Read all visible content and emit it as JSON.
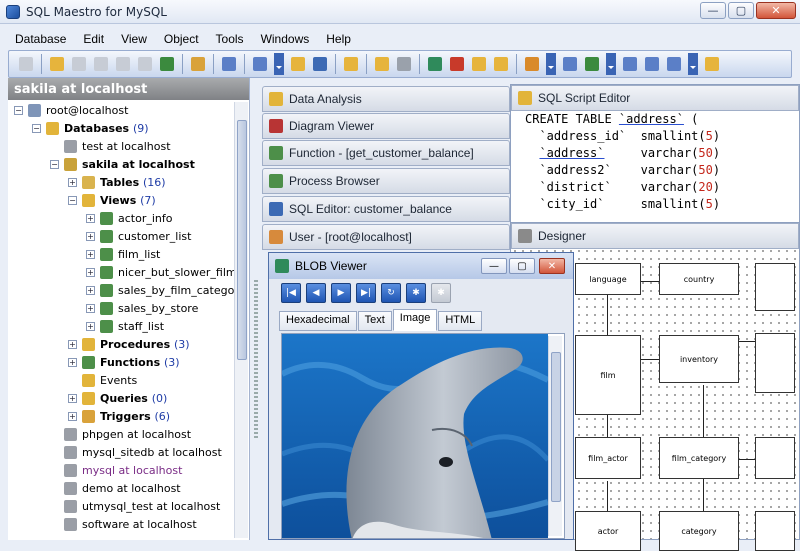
{
  "window": {
    "title": "SQL Maestro for MySQL"
  },
  "menu": [
    "Database",
    "Edit",
    "View",
    "Object",
    "Tools",
    "Windows",
    "Help"
  ],
  "explorer": {
    "header": "sakila at localhost",
    "items": [
      {
        "depth": 0,
        "exp": "-",
        "label": "root@localhost",
        "icon": "server-icon",
        "color": "#7f95b8"
      },
      {
        "depth": 1,
        "exp": "-",
        "label": "Databases",
        "count": "(9)",
        "bold": true,
        "icon": "databases-folder-icon",
        "color": "#e2b43a"
      },
      {
        "depth": 2,
        "exp": "",
        "label": "test at localhost",
        "icon": "database-icon",
        "color": "#9a9ea6"
      },
      {
        "depth": 2,
        "exp": "-",
        "label": "sakila at localhost",
        "bold": true,
        "icon": "database-icon",
        "color": "#c9a23a"
      },
      {
        "depth": 3,
        "exp": "+",
        "label": "Tables",
        "count": "(16)",
        "bold": true,
        "icon": "tables-icon",
        "color": "#d9b34e"
      },
      {
        "depth": 3,
        "exp": "-",
        "label": "Views",
        "count": "(7)",
        "bold": true,
        "icon": "views-icon",
        "color": "#e2b43a"
      },
      {
        "depth": 4,
        "exp": "+",
        "label": "actor_info",
        "icon": "view-icon",
        "color": "#4d8f49"
      },
      {
        "depth": 4,
        "exp": "+",
        "label": "customer_list",
        "icon": "view-icon",
        "color": "#4d8f49"
      },
      {
        "depth": 4,
        "exp": "+",
        "label": "film_list",
        "icon": "view-icon",
        "color": "#4d8f49"
      },
      {
        "depth": 4,
        "exp": "+",
        "label": "nicer_but_slower_film_",
        "icon": "view-icon",
        "color": "#4d8f49"
      },
      {
        "depth": 4,
        "exp": "+",
        "label": "sales_by_film_categor",
        "icon": "view-icon",
        "color": "#4d8f49"
      },
      {
        "depth": 4,
        "exp": "+",
        "label": "sales_by_store",
        "icon": "view-icon",
        "color": "#4d8f49"
      },
      {
        "depth": 4,
        "exp": "+",
        "label": "staff_list",
        "icon": "view-icon",
        "color": "#4d8f49"
      },
      {
        "depth": 3,
        "exp": "+",
        "label": "Procedures",
        "count": "(3)",
        "bold": true,
        "icon": "procedures-icon",
        "color": "#e2b43a"
      },
      {
        "depth": 3,
        "exp": "+",
        "label": "Functions",
        "count": "(3)",
        "bold": true,
        "icon": "functions-icon",
        "color": "#4d8f49"
      },
      {
        "depth": 3,
        "exp": "",
        "label": "Events",
        "icon": "events-icon",
        "color": "#e2b43a"
      },
      {
        "depth": 3,
        "exp": "+",
        "label": "Queries",
        "count": "(0)",
        "bold": true,
        "icon": "queries-icon",
        "color": "#e2b43a"
      },
      {
        "depth": 3,
        "exp": "+",
        "label": "Triggers",
        "count": "(6)",
        "bold": true,
        "icon": "triggers-icon",
        "color": "#d9a23a"
      },
      {
        "depth": 2,
        "exp": "",
        "label": "phpgen at localhost",
        "icon": "database-icon",
        "color": "#9a9ea6"
      },
      {
        "depth": 2,
        "exp": "",
        "label": "mysql_sitedb at localhost",
        "icon": "database-icon",
        "color": "#9a9ea6"
      },
      {
        "depth": 2,
        "exp": "",
        "label": "mysql at localhost",
        "purple": true,
        "icon": "database-icon",
        "color": "#9a9ea6"
      },
      {
        "depth": 2,
        "exp": "",
        "label": "demo at localhost",
        "icon": "database-icon",
        "color": "#9a9ea6"
      },
      {
        "depth": 2,
        "exp": "",
        "label": "utmysql_test at localhost",
        "icon": "database-icon",
        "color": "#9a9ea6"
      },
      {
        "depth": 2,
        "exp": "",
        "label": "software at localhost",
        "icon": "database-icon",
        "color": "#9a9ea6"
      }
    ]
  },
  "doc_tabs": [
    {
      "label": "Data Analysis",
      "icon": "data-analysis-icon",
      "color": "#e2b43a"
    },
    {
      "label": "Diagram Viewer",
      "icon": "diagram-viewer-icon",
      "color": "#b83434"
    },
    {
      "label": "Function - [get_customer_balance]",
      "icon": "function-icon",
      "color": "#4d8f49"
    },
    {
      "label": "Process Browser",
      "icon": "process-icon",
      "color": "#4d8f49"
    },
    {
      "label": "SQL Editor: customer_balance",
      "icon": "sql-editor-icon",
      "color": "#3c6ab4"
    },
    {
      "label": "User - [root@localhost]",
      "icon": "user-icon",
      "color": "#d78a3c"
    },
    {
      "label": "SQL Script Editor",
      "icon": "sql-script-icon",
      "color": "#e2b43a"
    },
    {
      "label": "Designer",
      "icon": "designer-icon",
      "color": "#8a8a8a"
    }
  ],
  "sql": [
    [
      {
        "t": "CREATE TABLE ",
        "c": "kw"
      },
      {
        "t": "`address`",
        "c": "u"
      },
      {
        "t": " ("
      }
    ],
    [
      {
        "t": "  `address_id`  "
      },
      {
        "t": "smallint"
      },
      {
        "t": "(",
        "c": ""
      },
      {
        "t": "5",
        "c": "num"
      },
      {
        "t": ")"
      }
    ],
    [
      {
        "t": "  "
      },
      {
        "t": "`address`",
        "c": "u"
      },
      {
        "t": "     varchar"
      },
      {
        "t": "(",
        "c": ""
      },
      {
        "t": "50",
        "c": "num"
      },
      {
        "t": ")"
      }
    ],
    [
      {
        "t": "  `address2`    varchar("
      },
      {
        "t": "50",
        "c": "num"
      },
      {
        "t": ")"
      }
    ],
    [
      {
        "t": "  `district`    varchar("
      },
      {
        "t": "20",
        "c": "num"
      },
      {
        "t": ")"
      }
    ],
    [
      {
        "t": "  `city_id`     smallint("
      },
      {
        "t": "5",
        "c": "num"
      },
      {
        "t": ")"
      }
    ]
  ],
  "designer": {
    "entities": [
      "language",
      "country",
      "film",
      "inventory",
      "film_actor",
      "film_category",
      "actor",
      "category"
    ]
  },
  "blob": {
    "title": "BLOB Viewer",
    "tabs": [
      "Hexadecimal",
      "Text",
      "Image",
      "HTML"
    ],
    "active_tab": "Image"
  }
}
